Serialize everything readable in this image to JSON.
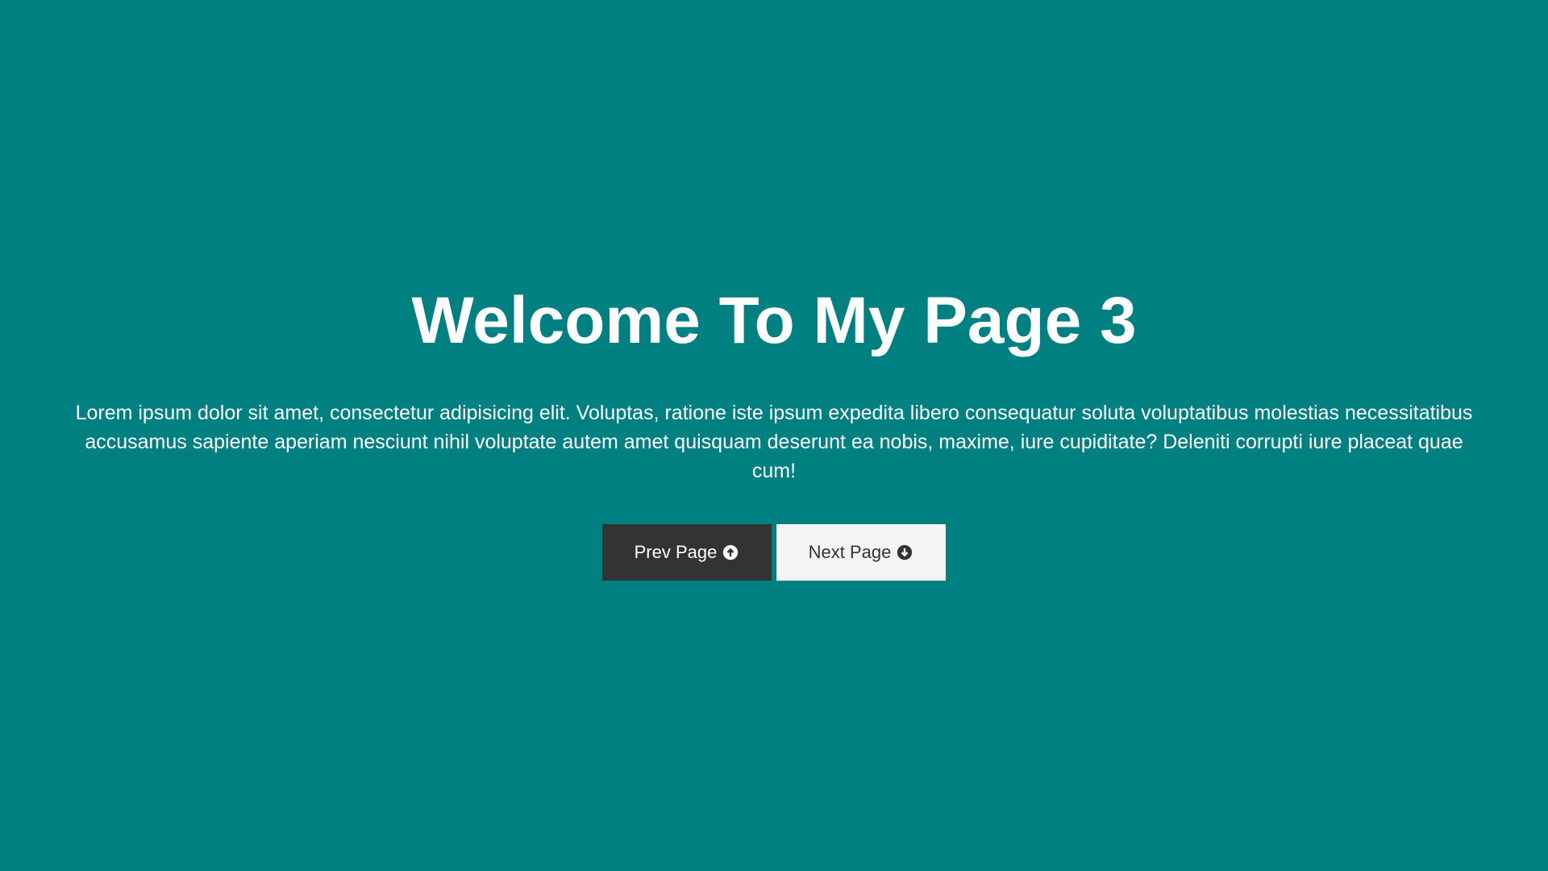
{
  "hero": {
    "title": "Welcome To My Page 3",
    "paragraph": "Lorem ipsum dolor sit amet, consectetur adipisicing elit. Voluptas, ratione iste ipsum expedita libero consequatur soluta voluptatibus molestias necessitatibus accusamus sapiente aperiam nesciunt nihil voluptate autem amet quisquam deserunt ea nobis, maxime, iure cupiditate? Deleniti corrupti iure placeat quae cum!"
  },
  "buttons": {
    "prev": {
      "label": "Prev Page",
      "icon": "arrow-circle-up-icon"
    },
    "next": {
      "label": "Next Page",
      "icon": "arrow-circle-down-icon"
    }
  },
  "colors": {
    "background": "#008080",
    "prev_button": "#333333",
    "next_button": "#f4f4f4",
    "text_light": "#ffffff",
    "text_dark": "#333333"
  }
}
